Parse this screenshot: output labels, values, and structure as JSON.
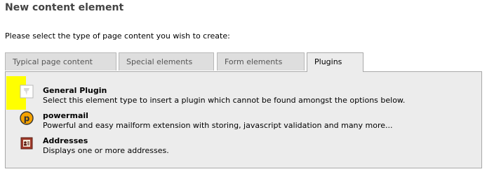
{
  "header": {
    "title": "New content element",
    "intro": "Please select the type of page content you wish to create:"
  },
  "tabs": [
    {
      "label": "Typical page content",
      "active": false
    },
    {
      "label": "Special elements",
      "active": false
    },
    {
      "label": "Form elements",
      "active": false
    },
    {
      "label": "Plugins",
      "active": true
    }
  ],
  "items": [
    {
      "title": "General Plugin",
      "description": "Select this element type to insert a plugin which cannot be found amongst the options below.",
      "icon": "typo3-plugin-icon"
    },
    {
      "title": "powermail",
      "description": "Powerful and easy mailform extension with storing, javascript validation and many more...",
      "icon": "powermail-icon"
    },
    {
      "title": "Addresses",
      "description": "Displays one or more addresses.",
      "icon": "address-book-icon"
    }
  ],
  "colors": {
    "highlight": "#ffff00",
    "panel_bg": "#ececec",
    "tab_bg": "#dedede",
    "powermail_orange": "#f5a200",
    "address_red": "#a0392a"
  }
}
